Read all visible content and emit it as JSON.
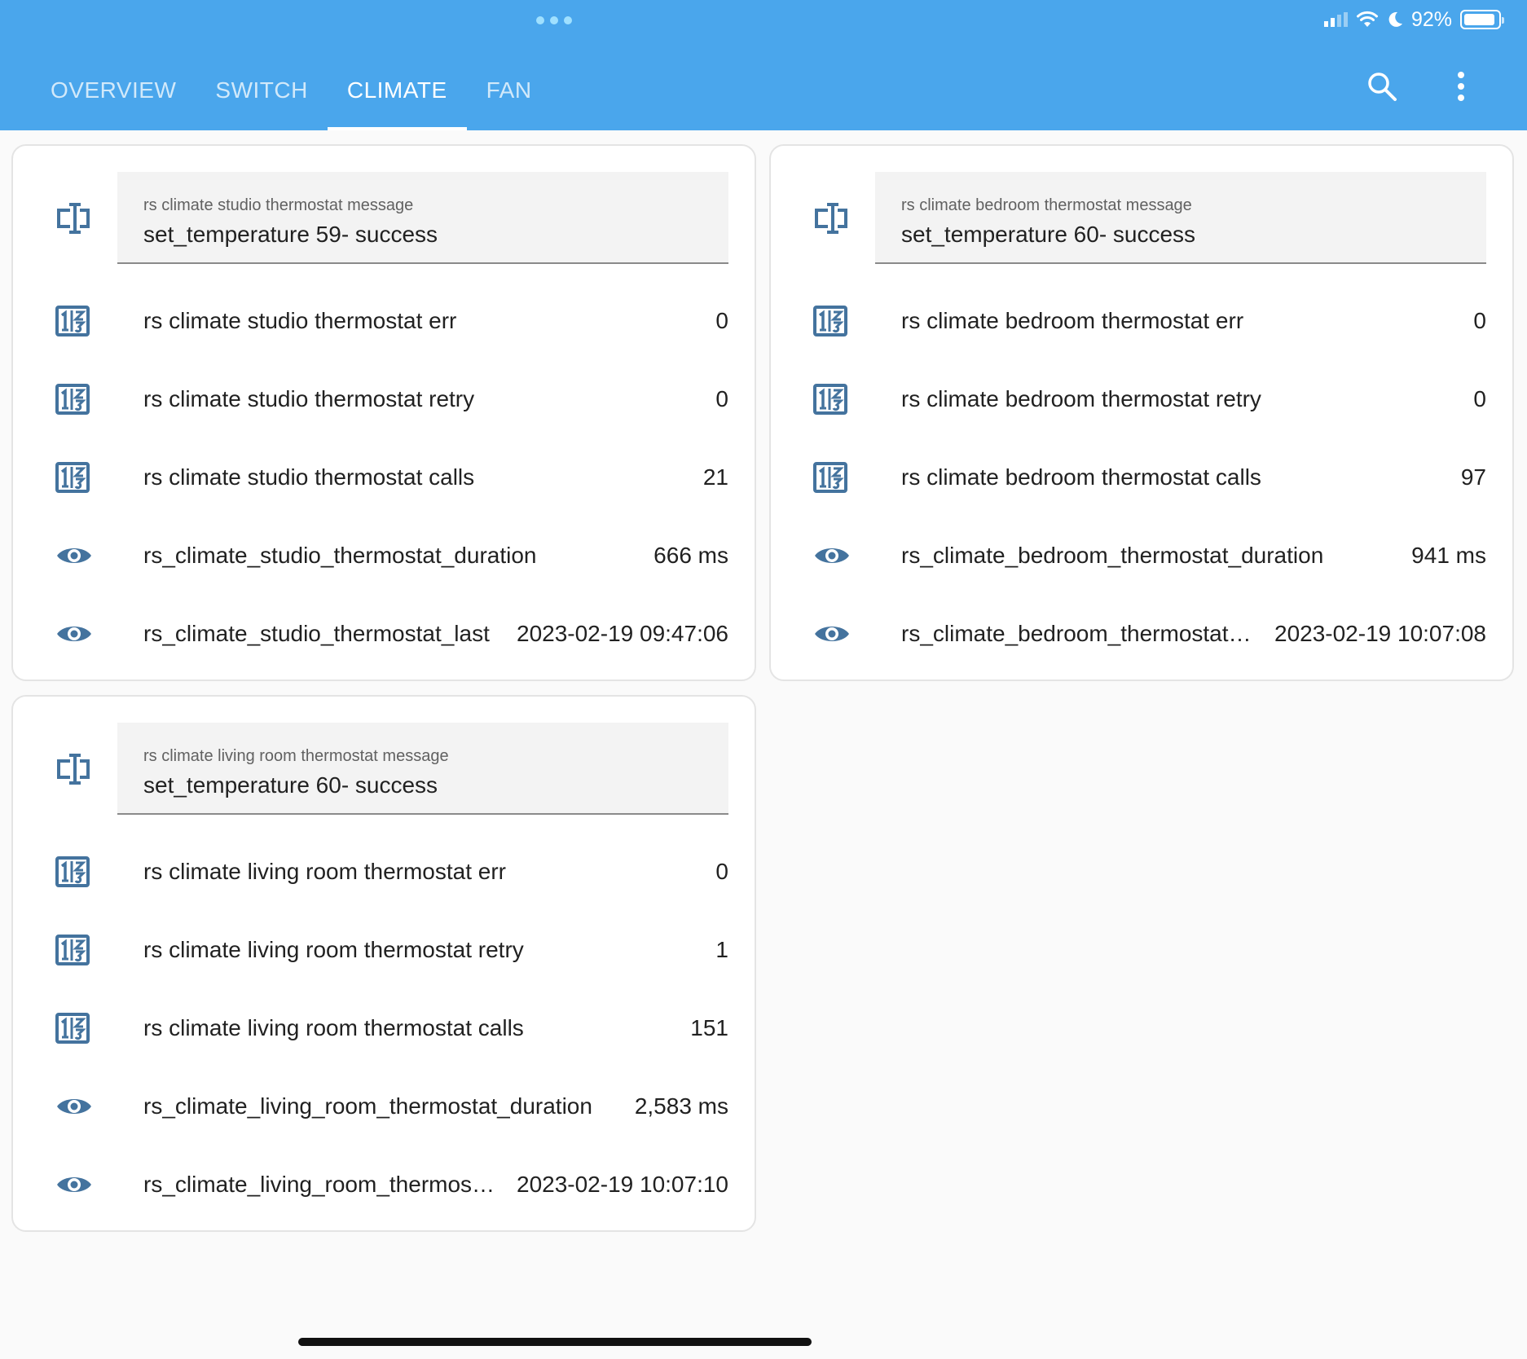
{
  "status_bar": {
    "battery_text": "92%"
  },
  "tabs": [
    {
      "label": "OVERVIEW",
      "active": false
    },
    {
      "label": "SWITCH",
      "active": false
    },
    {
      "label": "CLIMATE",
      "active": true
    },
    {
      "label": "FAN",
      "active": false
    }
  ],
  "header": {
    "search_icon": "search-icon",
    "menu_icon": "more-vert-icon"
  },
  "accent_color": "#4aa6ec",
  "icon_color": "#44739e",
  "cards": [
    {
      "message": {
        "label": "rs climate studio thermostat message",
        "value": "set_temperature 59- success",
        "icon": "form-textbox-icon"
      },
      "rows": [
        {
          "icon": "numeric-icon",
          "name": "rs climate studio thermostat err",
          "value": "0"
        },
        {
          "icon": "numeric-icon",
          "name": "rs climate studio thermostat retry",
          "value": "0"
        },
        {
          "icon": "numeric-icon",
          "name": "rs climate studio thermostat calls",
          "value": "21"
        },
        {
          "icon": "eye-icon",
          "name": "rs_climate_studio_thermostat_duration",
          "value": "666 ms"
        },
        {
          "icon": "eye-icon",
          "name": "rs_climate_studio_thermostat_last",
          "value": "2023-02-19 09:47:06"
        }
      ]
    },
    {
      "message": {
        "label": "rs climate bedroom thermostat message",
        "value": "set_temperature 60- success",
        "icon": "form-textbox-icon"
      },
      "rows": [
        {
          "icon": "numeric-icon",
          "name": "rs climate bedroom thermostat err",
          "value": "0"
        },
        {
          "icon": "numeric-icon",
          "name": "rs climate bedroom thermostat retry",
          "value": "0"
        },
        {
          "icon": "numeric-icon",
          "name": "rs climate bedroom thermostat calls",
          "value": "97"
        },
        {
          "icon": "eye-icon",
          "name": "rs_climate_bedroom_thermostat_duration",
          "value": "941 ms"
        },
        {
          "icon": "eye-icon",
          "name": "rs_climate_bedroom_thermostat_last",
          "value": "2023-02-19 10:07:08"
        }
      ]
    },
    {
      "message": {
        "label": "rs climate living room thermostat message",
        "value": "set_temperature 60- success",
        "icon": "form-textbox-icon"
      },
      "rows": [
        {
          "icon": "numeric-icon",
          "name": "rs climate living room thermostat err",
          "value": "0"
        },
        {
          "icon": "numeric-icon",
          "name": "rs climate living room thermostat retry",
          "value": "1"
        },
        {
          "icon": "numeric-icon",
          "name": "rs climate living room thermostat calls",
          "value": "151"
        },
        {
          "icon": "eye-icon",
          "name": "rs_climate_living_room_thermostat_duration",
          "value": "2,583 ms"
        },
        {
          "icon": "eye-icon",
          "name": "rs_climate_living_room_thermostat_last",
          "value": "2023-02-19 10:07:10"
        }
      ]
    }
  ]
}
